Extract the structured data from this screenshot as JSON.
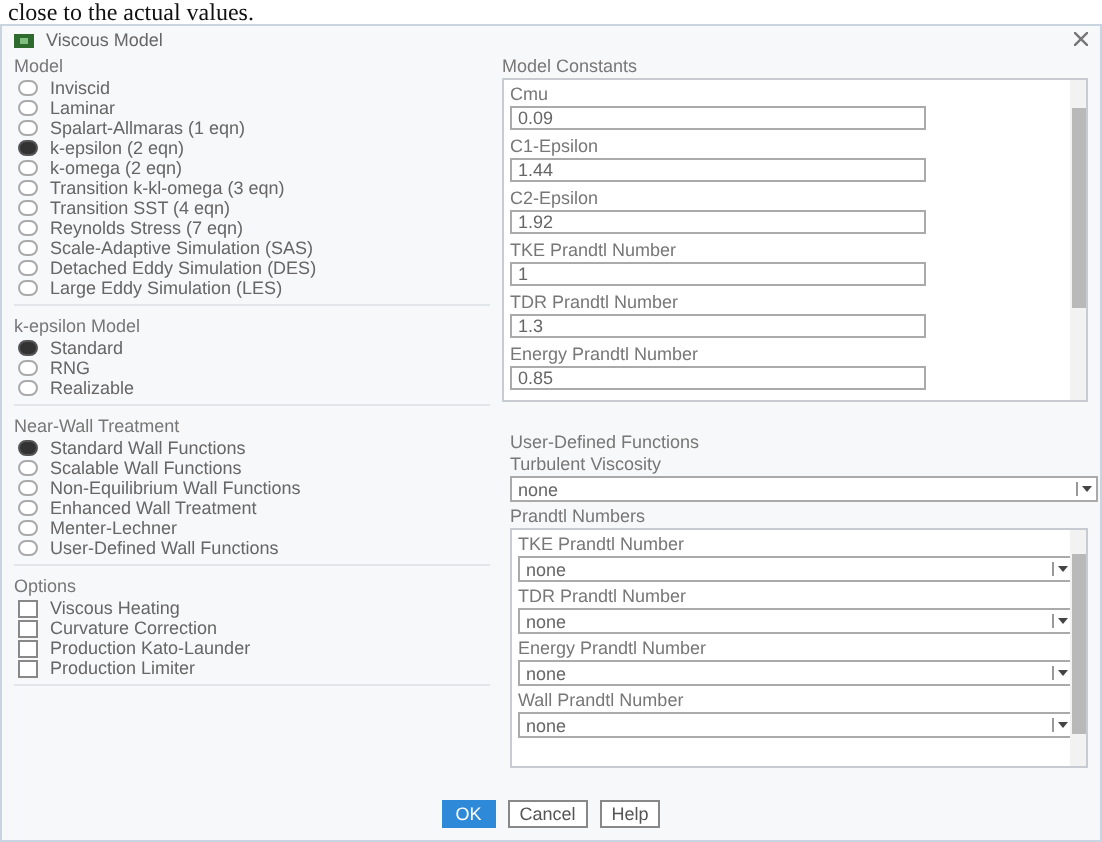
{
  "caption": "close to the actual values.",
  "window": {
    "title": "Viscous Model"
  },
  "model": {
    "label": "Model",
    "options": [
      {
        "label": "Inviscid",
        "selected": false
      },
      {
        "label": "Laminar",
        "selected": false
      },
      {
        "label": "Spalart-Allmaras (1 eqn)",
        "selected": false
      },
      {
        "label": "k-epsilon (2 eqn)",
        "selected": true
      },
      {
        "label": "k-omega (2 eqn)",
        "selected": false
      },
      {
        "label": "Transition k-kl-omega (3 eqn)",
        "selected": false
      },
      {
        "label": "Transition SST (4 eqn)",
        "selected": false
      },
      {
        "label": "Reynolds Stress (7 eqn)",
        "selected": false
      },
      {
        "label": "Scale-Adaptive Simulation (SAS)",
        "selected": false
      },
      {
        "label": "Detached Eddy Simulation (DES)",
        "selected": false
      },
      {
        "label": "Large Eddy Simulation (LES)",
        "selected": false
      }
    ]
  },
  "kepsilon_model": {
    "label": "k-epsilon Model",
    "options": [
      {
        "label": "Standard",
        "selected": true
      },
      {
        "label": "RNG",
        "selected": false
      },
      {
        "label": "Realizable",
        "selected": false
      }
    ]
  },
  "near_wall": {
    "label": "Near-Wall Treatment",
    "options": [
      {
        "label": "Standard Wall Functions",
        "selected": true
      },
      {
        "label": "Scalable Wall Functions",
        "selected": false
      },
      {
        "label": "Non-Equilibrium Wall Functions",
        "selected": false
      },
      {
        "label": "Enhanced Wall Treatment",
        "selected": false
      },
      {
        "label": "Menter-Lechner",
        "selected": false
      },
      {
        "label": "User-Defined Wall Functions",
        "selected": false
      }
    ]
  },
  "options": {
    "label": "Options",
    "items": [
      {
        "label": "Viscous Heating",
        "checked": false
      },
      {
        "label": "Curvature Correction",
        "checked": false
      },
      {
        "label": "Production Kato-Launder",
        "checked": false
      },
      {
        "label": "Production Limiter",
        "checked": false
      }
    ]
  },
  "constants": {
    "label": "Model Constants",
    "fields": [
      {
        "label": "Cmu",
        "value": "0.09"
      },
      {
        "label": "C1-Epsilon",
        "value": "1.44"
      },
      {
        "label": "C2-Epsilon",
        "value": "1.92"
      },
      {
        "label": "TKE Prandtl Number",
        "value": "1"
      },
      {
        "label": "TDR Prandtl Number",
        "value": "1.3"
      },
      {
        "label": "Energy Prandtl Number",
        "value": "0.85"
      }
    ]
  },
  "udf": {
    "label": "User-Defined Functions",
    "turbulent_viscosity": {
      "label": "Turbulent Viscosity",
      "value": "none"
    },
    "prandtl": {
      "label": "Prandtl Numbers",
      "fields": [
        {
          "label": "TKE Prandtl Number",
          "value": "none"
        },
        {
          "label": "TDR Prandtl Number",
          "value": "none"
        },
        {
          "label": "Energy Prandtl Number",
          "value": "none"
        },
        {
          "label": "Wall Prandtl Number",
          "value": "none"
        }
      ]
    }
  },
  "buttons": [
    {
      "label": "OK",
      "default": true
    },
    {
      "label": "Cancel",
      "default": false
    },
    {
      "label": "Help",
      "default": false
    }
  ]
}
